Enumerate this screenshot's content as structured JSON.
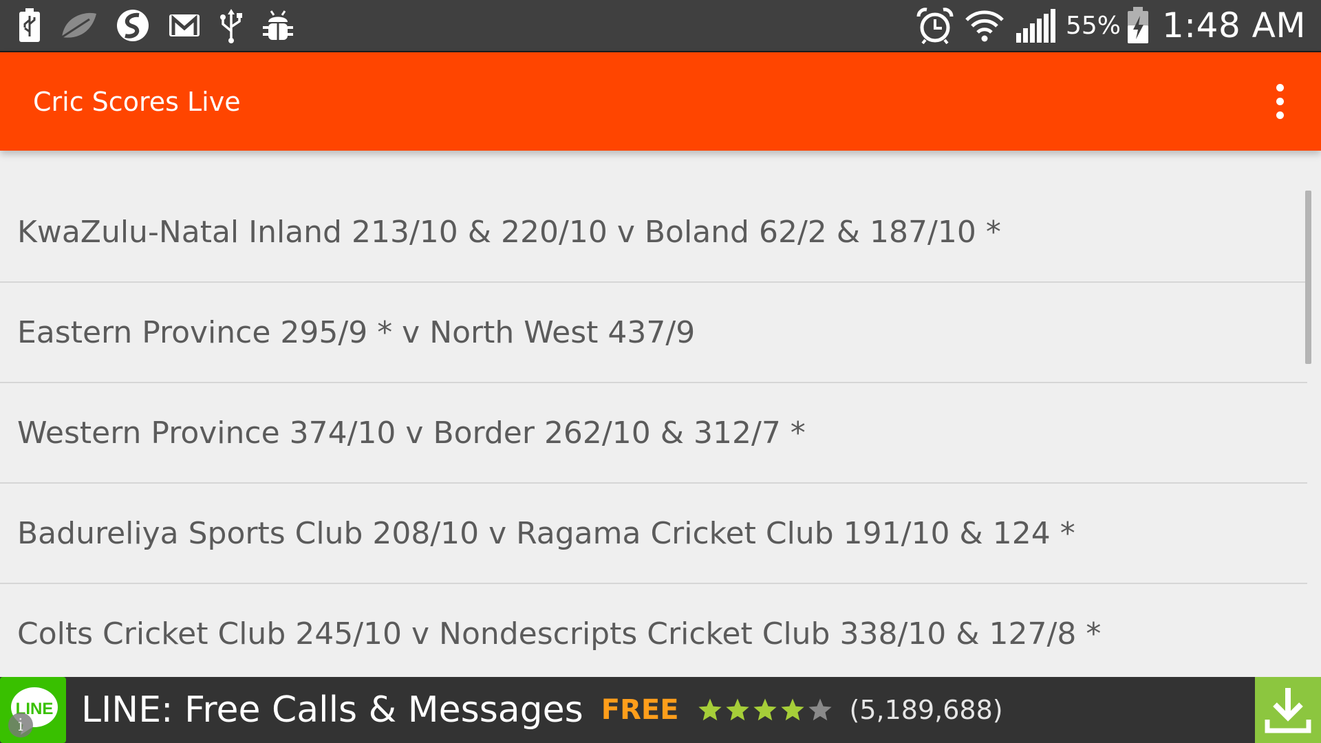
{
  "status_bar": {
    "left_icons": [
      "battery-saver-icon",
      "leaf-icon",
      "swype-icon",
      "gmail-icon",
      "usb-icon",
      "android-debug-icon"
    ],
    "right_icons": [
      "alarm-icon",
      "wifi-icon",
      "signal-icon",
      "battery-charging-icon"
    ],
    "battery_percent": "55%",
    "time": "1:48 AM"
  },
  "app_bar": {
    "title": "Cric Scores Live",
    "background": "#ff4500",
    "menu_icon": "overflow-menu-icon"
  },
  "matches": [
    {
      "label": "KwaZulu-Natal Inland 213/10 &  220/10  v Boland 62/2 &  187/10 *"
    },
    {
      "label": "Eastern Province 295/9 * v North West 437/9"
    },
    {
      "label": "Western Province 374/10  v Border 262/10 &  312/7 *"
    },
    {
      "label": "Badureliya Sports Club 208/10  v Ragama Cricket Club 191/10 &  124 *"
    },
    {
      "label": "Colts Cricket Club 245/10  v Nondescripts Cricket Club 338/10 &  127/8 *"
    }
  ],
  "ad": {
    "logo_text": "LINE",
    "title": "LINE: Free Calls & Messages",
    "price": "FREE",
    "rating": 4,
    "rating_max": 5,
    "reviews": "(5,189,688)",
    "download_icon": "download-icon",
    "info_icon": "info-icon",
    "colors": {
      "logo": "#39c000",
      "price": "#ff9e1b",
      "download": "#8cc63f",
      "star": "#a6ce39"
    }
  }
}
